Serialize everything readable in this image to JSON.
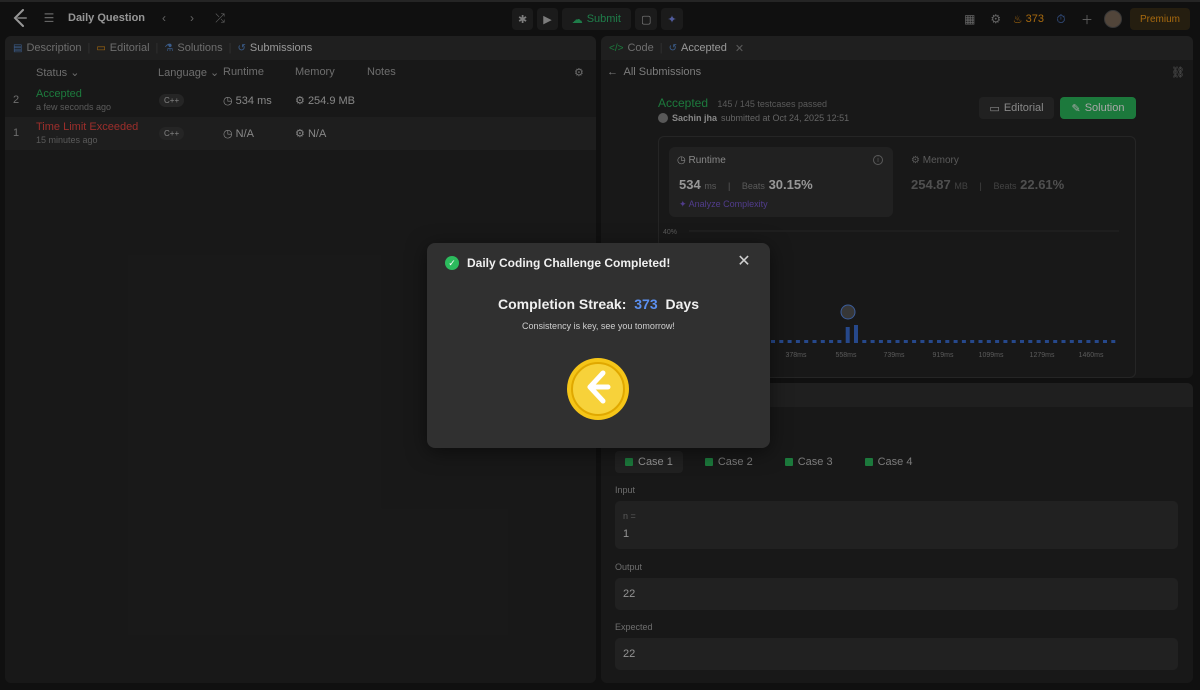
{
  "topbar": {
    "title": "Daily Question",
    "submit_label": "Submit",
    "streak_count": "373",
    "premium_label": "Premium"
  },
  "left": {
    "tabs": [
      {
        "label": "Description"
      },
      {
        "label": "Editorial"
      },
      {
        "label": "Solutions"
      },
      {
        "label": "Submissions"
      }
    ],
    "columns": {
      "status": "Status",
      "language": "Language",
      "runtime": "Runtime",
      "memory": "Memory",
      "notes": "Notes"
    },
    "rows": [
      {
        "index": "2",
        "status": "Accepted",
        "time": "a few seconds ago",
        "language": "C++",
        "runtime": "534 ms",
        "memory": "254.9 MB"
      },
      {
        "index": "1",
        "status": "Time Limit Exceeded",
        "time": "15 minutes ago",
        "language": "C++",
        "runtime": "N/A",
        "memory": "N/A"
      }
    ]
  },
  "right_top": {
    "tabs": [
      {
        "label": "Code"
      },
      {
        "label": "Accepted"
      }
    ],
    "back_label": "All Submissions",
    "status": "Accepted",
    "testcases": "145 / 145 testcases passed",
    "author": "Sachin jha",
    "submitted": "submitted at Oct 24, 2025 12:51",
    "editorial_label": "Editorial",
    "solution_label": "Solution",
    "runtime": {
      "label": "Runtime",
      "value": "534",
      "unit": "ms",
      "beats_label": "Beats",
      "beats": "30.15%",
      "analyze": "Analyze Complexity"
    },
    "memory": {
      "label": "Memory",
      "value": "254.87",
      "unit": "MB",
      "beats_label": "Beats",
      "beats": "22.61%"
    }
  },
  "right_bottom": {
    "cases": [
      {
        "label": "Case 1"
      },
      {
        "label": "Case 2"
      },
      {
        "label": "Case 3"
      },
      {
        "label": "Case 4"
      }
    ],
    "input_label": "Input",
    "input_key": "n =",
    "input_value": "1",
    "output_label": "Output",
    "output_value": "22",
    "expected_label": "Expected",
    "expected_value": "22"
  },
  "chart_data": {
    "type": "bar",
    "y_tick_labels": [
      "40%"
    ],
    "x_tick_labels": [
      "378ms",
      "558ms",
      "739ms",
      "919ms",
      "1099ms",
      "1279ms",
      "1460ms"
    ],
    "bar_color": "#3b6fd6"
  },
  "modal": {
    "title": "Daily Coding Challenge Completed!",
    "streak_label": "Completion Streak:",
    "streak_value": "373",
    "streak_unit": "Days",
    "message": "Consistency is key, see you tomorrow!"
  }
}
